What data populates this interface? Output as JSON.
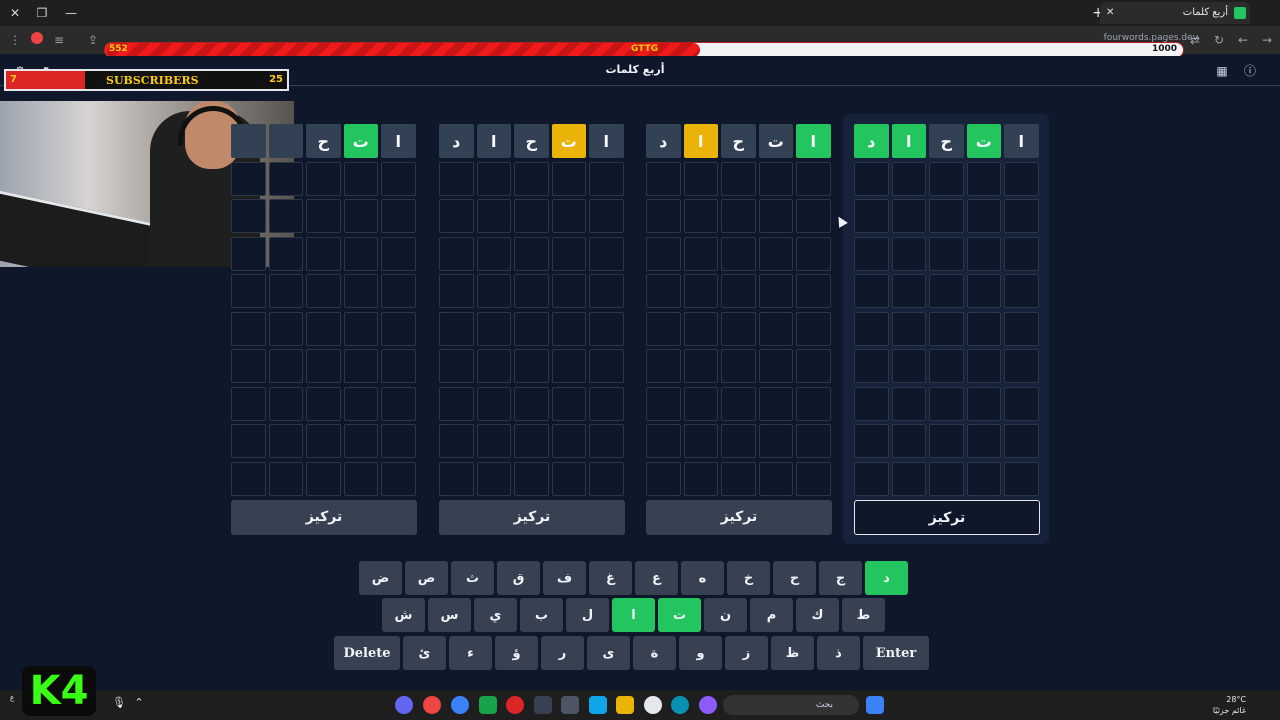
{
  "browser": {
    "tab_title": "أربع كلمات",
    "url": "fourwords.pages.dev"
  },
  "goal_bar": {
    "current": "552",
    "name": "GTTG",
    "max": "1000",
    "progress_fraction": 0.552
  },
  "subscribers": {
    "current": "7",
    "label": "SUBSCRIBERS",
    "goal": "25",
    "progress_fraction": 0.28
  },
  "app": {
    "title": "أربع كلمات"
  },
  "boards": [
    {
      "rows": [
        [
          "",
          "",
          "ح",
          "ت",
          "ا"
        ]
      ],
      "states": [
        [
          "filled",
          "filled",
          "filled",
          "green",
          "filled"
        ]
      ],
      "focus_label": "تركيز",
      "active": false
    },
    {
      "rows": [
        [
          "د",
          "ا",
          "ح",
          "ت",
          "ا"
        ]
      ],
      "states": [
        [
          "filled",
          "filled",
          "filled",
          "yellow",
          "filled"
        ]
      ],
      "focus_label": "تركيز",
      "active": false
    },
    {
      "rows": [
        [
          "د",
          "ا",
          "ح",
          "ت",
          "ا"
        ]
      ],
      "states": [
        [
          "filled",
          "yellow",
          "filled",
          "filled",
          "green"
        ]
      ],
      "focus_label": "تركيز",
      "active": false
    },
    {
      "rows": [
        [
          "د",
          "ا",
          "ح",
          "ت",
          "ا"
        ]
      ],
      "states": [
        [
          "green",
          "green",
          "filled",
          "green",
          "filled"
        ]
      ],
      "focus_label": "تركيز",
      "active": true
    }
  ],
  "keyboard": {
    "row1": [
      "ض",
      "ص",
      "ث",
      "ق",
      "ف",
      "غ",
      "ع",
      "ه",
      "خ",
      "ح",
      "ج",
      "د"
    ],
    "row1_states": [
      "",
      "",
      "",
      "",
      "",
      "",
      "",
      "",
      "",
      "",
      "",
      "green"
    ],
    "row2": [
      "ش",
      "س",
      "ي",
      "ب",
      "ل",
      "ا",
      "ت",
      "ن",
      "م",
      "ك",
      "ط"
    ],
    "row2_states": [
      "",
      "",
      "",
      "",
      "",
      "green",
      "green",
      "",
      "",
      "",
      ""
    ],
    "row3": [
      "ئ",
      "ء",
      "ؤ",
      "ر",
      "ى",
      "ة",
      "و",
      "ز",
      "ظ",
      "ذ"
    ],
    "delete_label": "Delete",
    "enter_label": "Enter"
  },
  "taskbar": {
    "search_placeholder": "بحث",
    "temperature": "28°C",
    "weather": "غائم جزئيًا",
    "lang": "ع"
  },
  "overlay_logo": "K4"
}
